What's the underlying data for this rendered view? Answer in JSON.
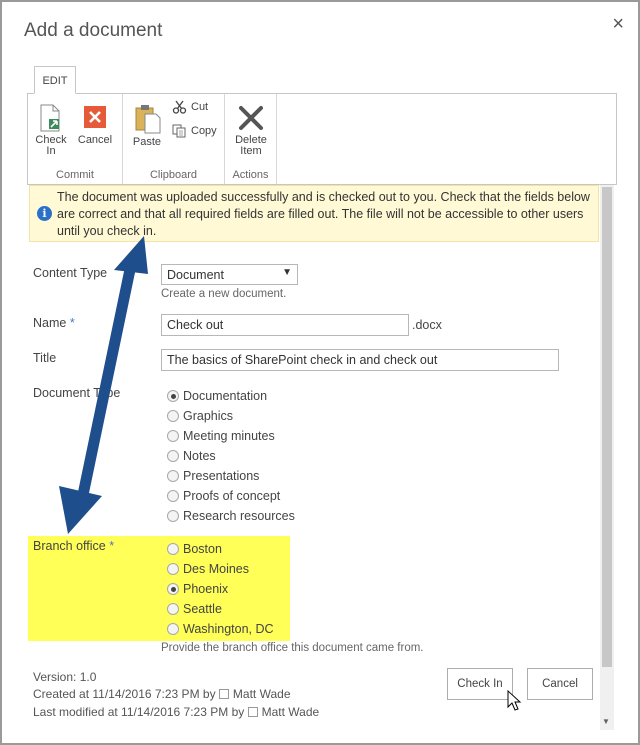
{
  "dialog": {
    "title": "Add a document",
    "close_label": "×"
  },
  "ribbon": {
    "tab": "EDIT",
    "groups": {
      "commit": {
        "label": "Commit",
        "check_in": "Check\nIn",
        "cancel": "Cancel"
      },
      "clipboard": {
        "label": "Clipboard",
        "paste": "Paste",
        "cut": "Cut",
        "copy": "Copy"
      },
      "actions": {
        "label": "Actions",
        "delete_item": "Delete\nItem"
      }
    }
  },
  "info": {
    "icon": "i",
    "message": "The document was uploaded successfully and is checked out to you. Check that the fields below are correct and that all required fields are filled out. The file will not be accessible to other users until you check in."
  },
  "form": {
    "content_type": {
      "label": "Content Type",
      "value": "Document",
      "hint": "Create a new document."
    },
    "name": {
      "label": "Name",
      "required_marker": "*",
      "value": "Check out",
      "suffix": ".docx"
    },
    "title": {
      "label": "Title",
      "value": "The basics of SharePoint check in and check out"
    },
    "document_type": {
      "label": "Document Type",
      "options": [
        "Documentation",
        "Graphics",
        "Meeting minutes",
        "Notes",
        "Presentations",
        "Proofs of concept",
        "Research resources"
      ],
      "selected": "Documentation"
    },
    "branch_office": {
      "label": "Branch office",
      "required_marker": "*",
      "options": [
        "Boston",
        "Des Moines",
        "Phoenix",
        "Seattle",
        "Washington, DC"
      ],
      "selected": "Phoenix",
      "hint": "Provide the branch office this document came from."
    }
  },
  "footer": {
    "version": "Version: 1.0",
    "created": "Created at 11/14/2016 7:23 PM  by",
    "created_by": "Matt Wade",
    "modified": "Last modified at 11/14/2016 7:23 PM  by",
    "modified_by": "Matt Wade"
  },
  "buttons": {
    "check_in": "Check In",
    "cancel": "Cancel"
  },
  "colors": {
    "highlight": "#ffff57",
    "arrow": "#1f4e8c",
    "info_bg": "#fff9d6"
  }
}
